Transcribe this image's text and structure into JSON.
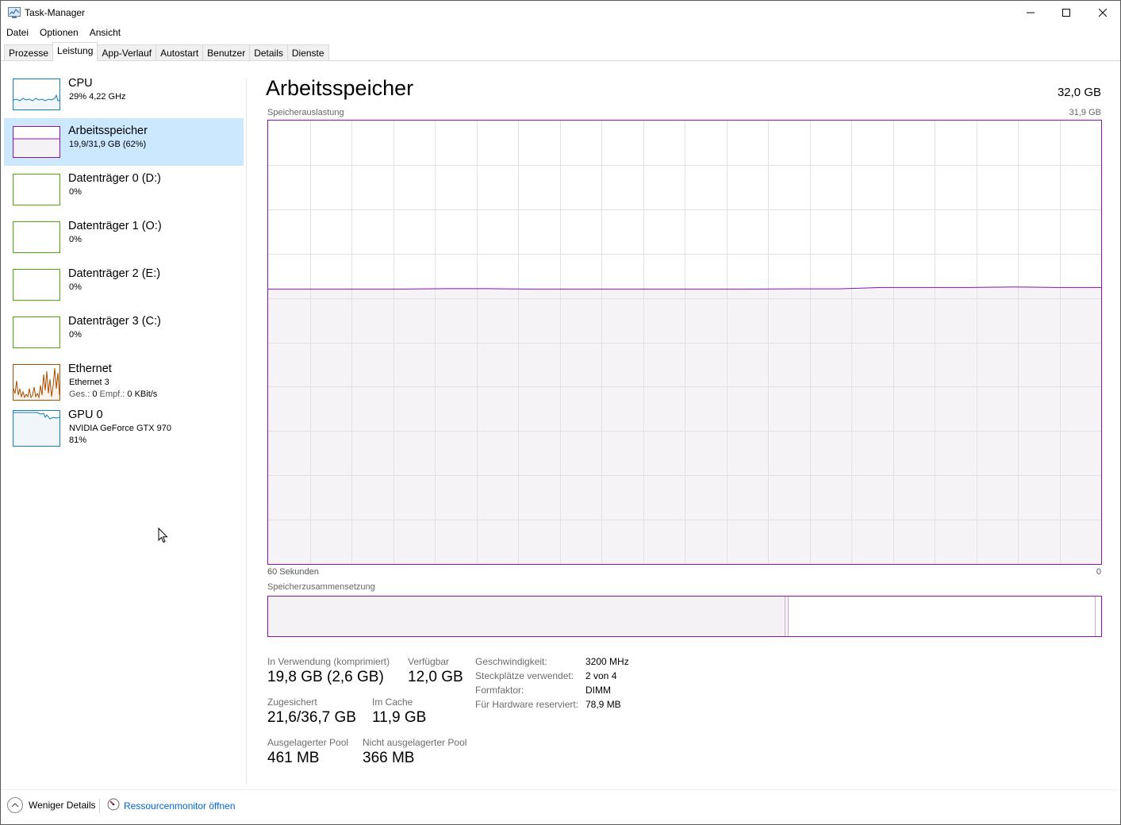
{
  "window": {
    "title": "Task-Manager",
    "controls": [
      "minimize",
      "maximize",
      "close"
    ]
  },
  "menu": [
    "Datei",
    "Optionen",
    "Ansicht"
  ],
  "tabs": [
    {
      "label": "Prozesse",
      "active": false
    },
    {
      "label": "Leistung",
      "active": true
    },
    {
      "label": "App-Verlauf",
      "active": false
    },
    {
      "label": "Autostart",
      "active": false
    },
    {
      "label": "Benutzer",
      "active": false
    },
    {
      "label": "Details",
      "active": false
    },
    {
      "label": "Dienste",
      "active": false
    }
  ],
  "sidebar": {
    "items": [
      {
        "name": "CPU",
        "line1": "29%  4,22 GHz",
        "line2": "",
        "color": "#117dbb",
        "selected": false
      },
      {
        "name": "Arbeitsspeicher",
        "line1": "19,9/31,9 GB (62%)",
        "line2": "",
        "color": "#8b12ae",
        "selected": true
      },
      {
        "name": "Datenträger 0 (D:)",
        "line1": "0%",
        "line2": "",
        "color": "#4da60c",
        "selected": false
      },
      {
        "name": "Datenträger 1 (O:)",
        "line1": "0%",
        "line2": "",
        "color": "#4da60c",
        "selected": false
      },
      {
        "name": "Datenträger 2 (E:)",
        "line1": "0%",
        "line2": "",
        "color": "#4da60c",
        "selected": false
      },
      {
        "name": "Datenträger 3 (C:)",
        "line1": "0%",
        "line2": "",
        "color": "#4da60c",
        "selected": false
      },
      {
        "name": "Ethernet",
        "line1": "Ethernet 3",
        "line2_label_send": "Ges.:",
        "line2_send": "0",
        "line2_label_recv": "Empf.:",
        "line2_recv": "0 KBit/s",
        "color": "#a74f01",
        "selected": false
      },
      {
        "name": "GPU 0",
        "line1": "NVIDIA GeForce GTX 970",
        "line2": "81%",
        "color": "#117dbb",
        "selected": false
      }
    ]
  },
  "main": {
    "title": "Arbeitsspeicher",
    "total": "32,0 GB",
    "graph_label": "Speicherauslastung",
    "graph_max": "31,9 GB",
    "axis_left": "60 Sekunden",
    "axis_right": "0",
    "composition_label": "Speicherzusammensetzung",
    "accent": "#8b12ae",
    "usage_fraction": 0.62
  },
  "stats": {
    "in_use_label": "In Verwendung (komprimiert)",
    "in_use_value": "19,8 GB (2,6 GB)",
    "available_label": "Verfügbar",
    "available_value": "12,0 GB",
    "committed_label": "Zugesichert",
    "committed_value": "21,6/36,7 GB",
    "cached_label": "Im Cache",
    "cached_value": "11,9 GB",
    "paged_label": "Ausgelagerter Pool",
    "paged_value": "461 MB",
    "nonpaged_label": "Nicht ausgelagerter Pool",
    "nonpaged_value": "366 MB"
  },
  "specs": [
    {
      "key": "Geschwindigkeit:",
      "value": "3200 MHz"
    },
    {
      "key": "Steckplätze verwendet:",
      "value": "2 von 4"
    },
    {
      "key": "Formfaktor:",
      "value": "DIMM"
    },
    {
      "key": "Für Hardware reserviert:",
      "value": "78,9 MB"
    }
  ],
  "footer": {
    "fewer_details": "Weniger Details",
    "resource_monitor": "Ressourcenmonitor öffnen"
  }
}
